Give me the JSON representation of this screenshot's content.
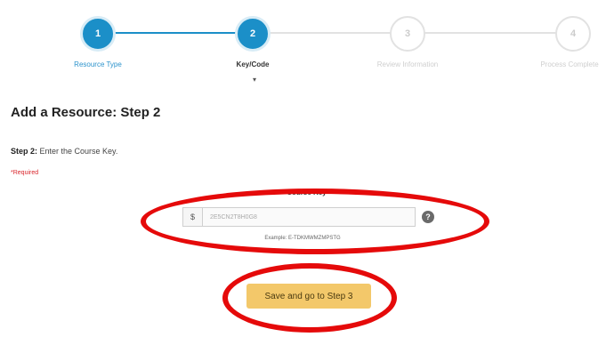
{
  "stepper": {
    "steps": [
      {
        "number": "1",
        "label": "Resource Type",
        "state": "done"
      },
      {
        "number": "2",
        "label": "Key/Code",
        "state": "active"
      },
      {
        "number": "3",
        "label": "Review Information",
        "state": "todo"
      },
      {
        "number": "4",
        "label": "Process Complete",
        "state": "todo"
      }
    ],
    "active_caret": "▾"
  },
  "page_title": "Add a Resource: Step 2",
  "instruction": {
    "prefix": "Step 2:",
    "text": " Enter the Course Key."
  },
  "required_note": "*Required",
  "course_key": {
    "label": "Course Key",
    "required_mark": "*",
    "prefix": "$",
    "value": "2E5CN2T8H0G8",
    "example": "Example: E-TDKMWMZMPSTG"
  },
  "help_icon": "question-icon",
  "submit_label": "Save and go to Step 3",
  "colors": {
    "accent": "#1b8fc8",
    "button": "#f3c86a",
    "required": "#d9262c",
    "annotation": "#e50a0a"
  }
}
